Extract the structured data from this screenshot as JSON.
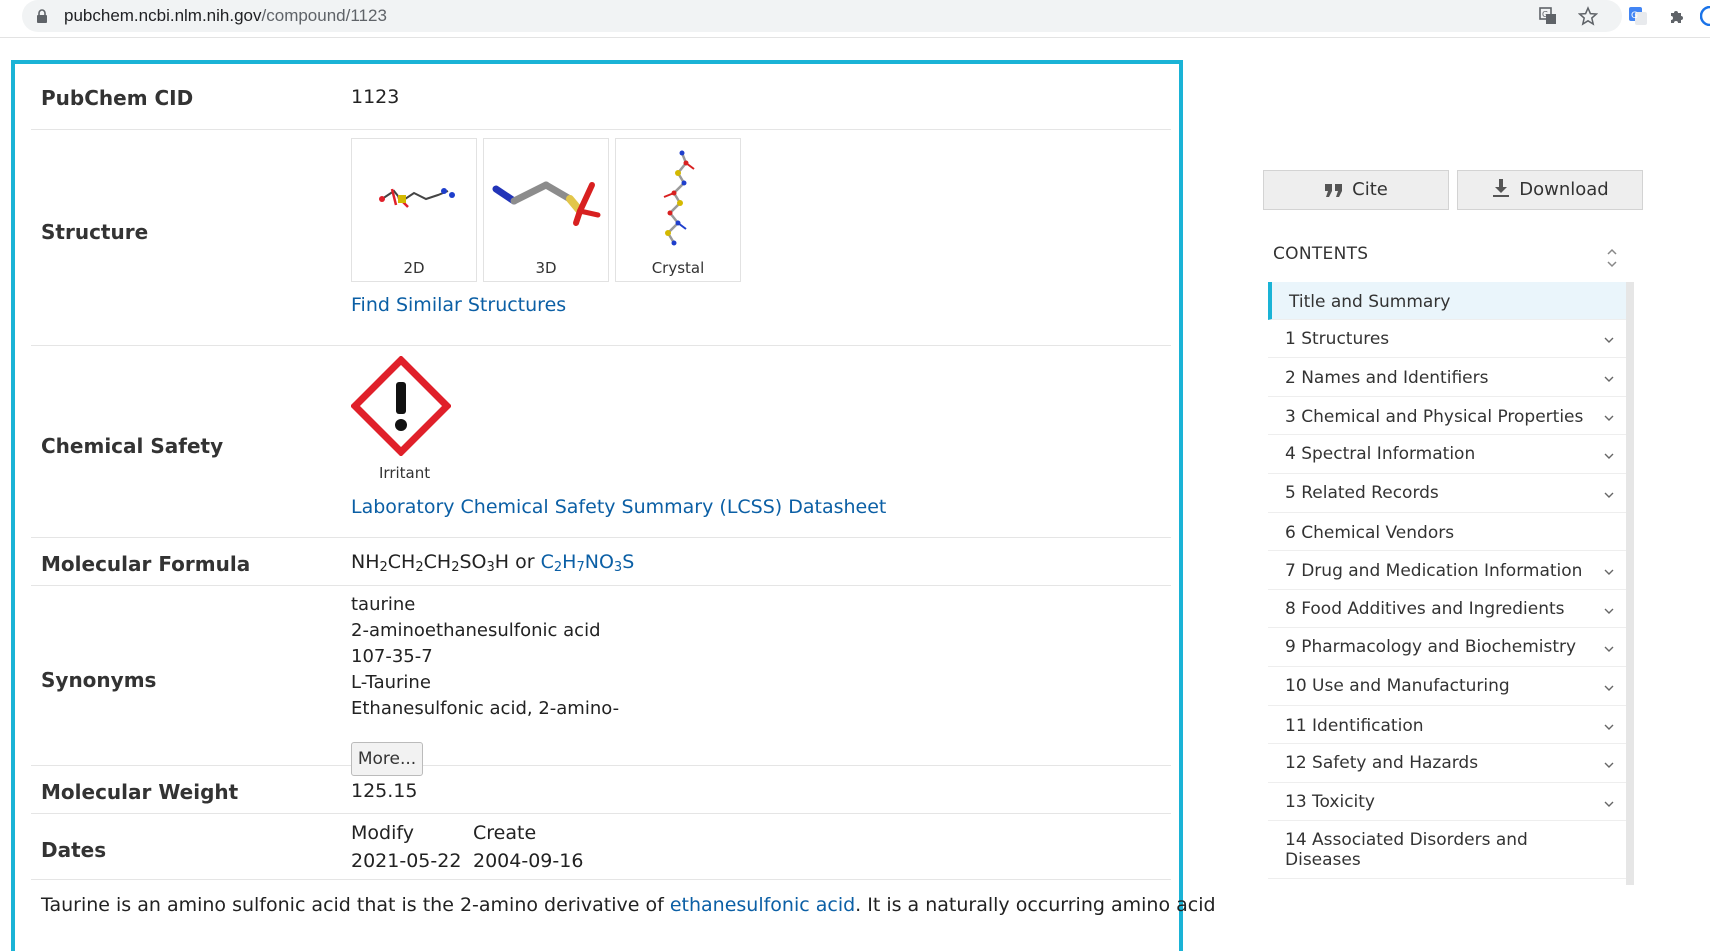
{
  "browser": {
    "url_host": "pubchem.ncbi.nlm.nih.gov",
    "url_path": "/compound/1123"
  },
  "summary": {
    "cid_label": "PubChem CID",
    "cid_value": "1123",
    "structure_label": "Structure",
    "structure_thumbs": [
      "2D",
      "3D",
      "Crystal"
    ],
    "find_similar": "Find Similar Structures",
    "safety_label": "Chemical Safety",
    "safety_pictogram": "Irritant",
    "lcss_link": "Laboratory Chemical Safety Summary (LCSS) Datasheet",
    "formula_label": "Molecular Formula",
    "formula_text_parts": [
      "NH",
      "2",
      "CH",
      "2",
      "CH",
      "2",
      "SO",
      "3",
      "H"
    ],
    "formula_or": "or",
    "formula_link_parts": [
      "C",
      "2",
      "H",
      "7",
      "NO",
      "3",
      "S"
    ],
    "synonyms_label": "Synonyms",
    "synonyms": [
      "taurine",
      "2-aminoethanesulfonic acid",
      "107-35-7",
      "L-Taurine",
      "Ethanesulfonic acid, 2-amino-"
    ],
    "more_button": "More...",
    "weight_label": "Molecular Weight",
    "weight_value": "125.15",
    "dates_label": "Dates",
    "modify_label": "Modify",
    "create_label": "Create",
    "modify_value": "2021-05-22",
    "create_value": "2004-09-16",
    "description_start": "Taurine is an amino sulfonic acid that is the 2-amino derivative of",
    "description_link": "ethanesulfonic acid",
    "description_end": ". It is a naturally occurring amino acid"
  },
  "sidebar": {
    "cite_label": "Cite",
    "download_label": "Download",
    "contents_title": "CONTENTS",
    "toc": [
      {
        "label": "Title and Summary",
        "expandable": false,
        "active": true
      },
      {
        "label": "1 Structures",
        "expandable": true
      },
      {
        "label": "2 Names and Identifiers",
        "expandable": true
      },
      {
        "label": "3 Chemical and Physical Properties",
        "expandable": true
      },
      {
        "label": "4 Spectral Information",
        "expandable": true
      },
      {
        "label": "5 Related Records",
        "expandable": true
      },
      {
        "label": "6 Chemical Vendors",
        "expandable": false
      },
      {
        "label": "7 Drug and Medication Information",
        "expandable": true
      },
      {
        "label": "8 Food Additives and Ingredients",
        "expandable": true
      },
      {
        "label": "9 Pharmacology and Biochemistry",
        "expandable": true
      },
      {
        "label": "10 Use and Manufacturing",
        "expandable": true
      },
      {
        "label": "11 Identification",
        "expandable": true
      },
      {
        "label": "12 Safety and Hazards",
        "expandable": true
      },
      {
        "label": "13 Toxicity",
        "expandable": true
      },
      {
        "label": "14 Associated Disorders and Diseases",
        "expandable": false
      }
    ]
  },
  "colors": {
    "accent": "#1ab3d6",
    "link": "#0b5fa5",
    "hazard_red": "#e0202a"
  }
}
